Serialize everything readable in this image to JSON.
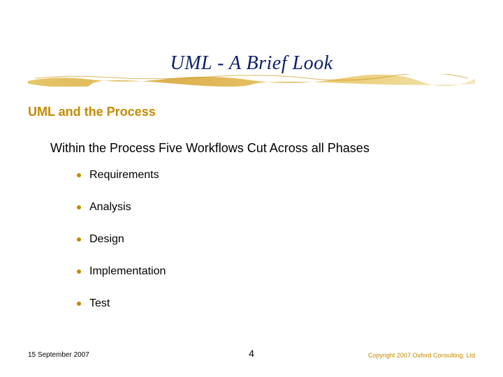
{
  "title": "UML - A Brief Look",
  "subheader": "UML and the Process",
  "intro": "Within the Process Five Workflows Cut Across all Phases",
  "bullets": [
    "Requirements",
    "Analysis",
    "Design",
    "Implementation",
    "Test"
  ],
  "footer": {
    "date": "15 September 2007",
    "page": "4",
    "copyright": "Copyright 2007 Oxford Consulting, Ltd"
  },
  "colors": {
    "accent": "#c48a00",
    "title": "#0b1f6b"
  }
}
